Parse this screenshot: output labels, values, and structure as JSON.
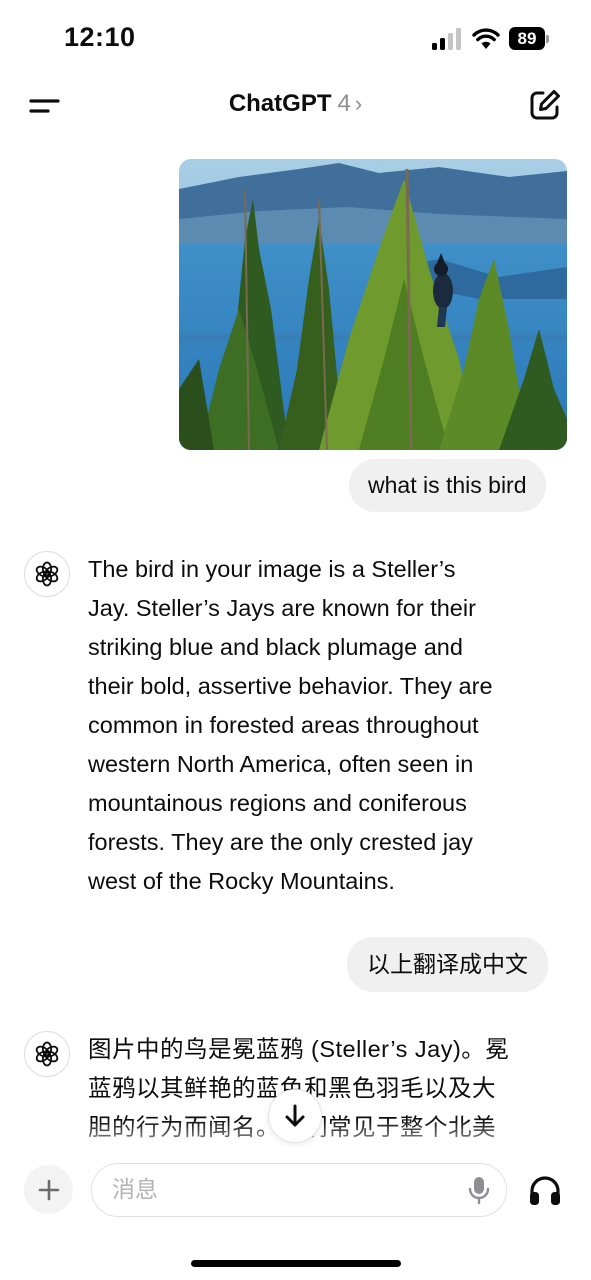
{
  "status_bar": {
    "time": "12:10",
    "battery": "89"
  },
  "nav": {
    "brand": "ChatGPT",
    "model": "4",
    "chevron": "›"
  },
  "messages": {
    "user_1": "what is this bird",
    "assistant_1_lines": [
      "The bird in your image is a Steller’s",
      "Jay. Steller’s Jays are known for their",
      "striking blue and black plumage and",
      "their bold, assertive behavior. They are",
      "common in forested areas throughout",
      "western North America, often seen in",
      "mountainous regions and coniferous",
      "forests. They are the only crested jay",
      "west of the Rocky Mountains."
    ],
    "user_2": "以上翻译成中文",
    "assistant_2_lines": [
      "图片中的鸟是冕蓝鸦 (Steller’s Jay)。冕",
      "蓝鸦以其鲜艳的蓝色和黑色羽毛以及大",
      "胆的行为而闻名。它们常见于整个北美"
    ]
  },
  "composer": {
    "placeholder": "消息"
  },
  "icons": {
    "menu": "menu-icon",
    "new_chat": "edit-icon",
    "assistant_avatar": "openai-logo-icon",
    "scroll_down": "arrow-down-icon",
    "plus": "plus-icon",
    "mic": "microphone-icon",
    "voice": "headphones-icon"
  },
  "colors": {
    "bubble": "#f0f0f0",
    "text": "#0d0d0d",
    "muted": "#8e8e93"
  }
}
